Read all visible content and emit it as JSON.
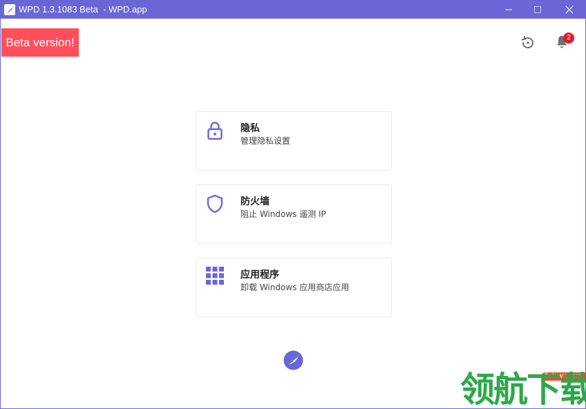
{
  "window": {
    "title": "WPD 1.3.1083 Beta  - WPD.app"
  },
  "header": {
    "beta_badge": "Beta version!",
    "notification_count": "2"
  },
  "cards": [
    {
      "title": "隐私",
      "description": "管理隐私设置",
      "icon": "lock-icon"
    },
    {
      "title": "防火墙",
      "description": "阻止 Windows 遥测 IP",
      "icon": "shield-icon"
    },
    {
      "title": "应用程序",
      "description": "卸载 Windows 应用商店应用",
      "icon": "grid-icon"
    }
  ],
  "watermark": {
    "url": "lhdown.com",
    "text": "领航下载"
  },
  "colors": {
    "accent": "#6b66d6",
    "beta": "#ff4f5a",
    "badge": "#e11d2f",
    "watermark": "#2da84a"
  }
}
